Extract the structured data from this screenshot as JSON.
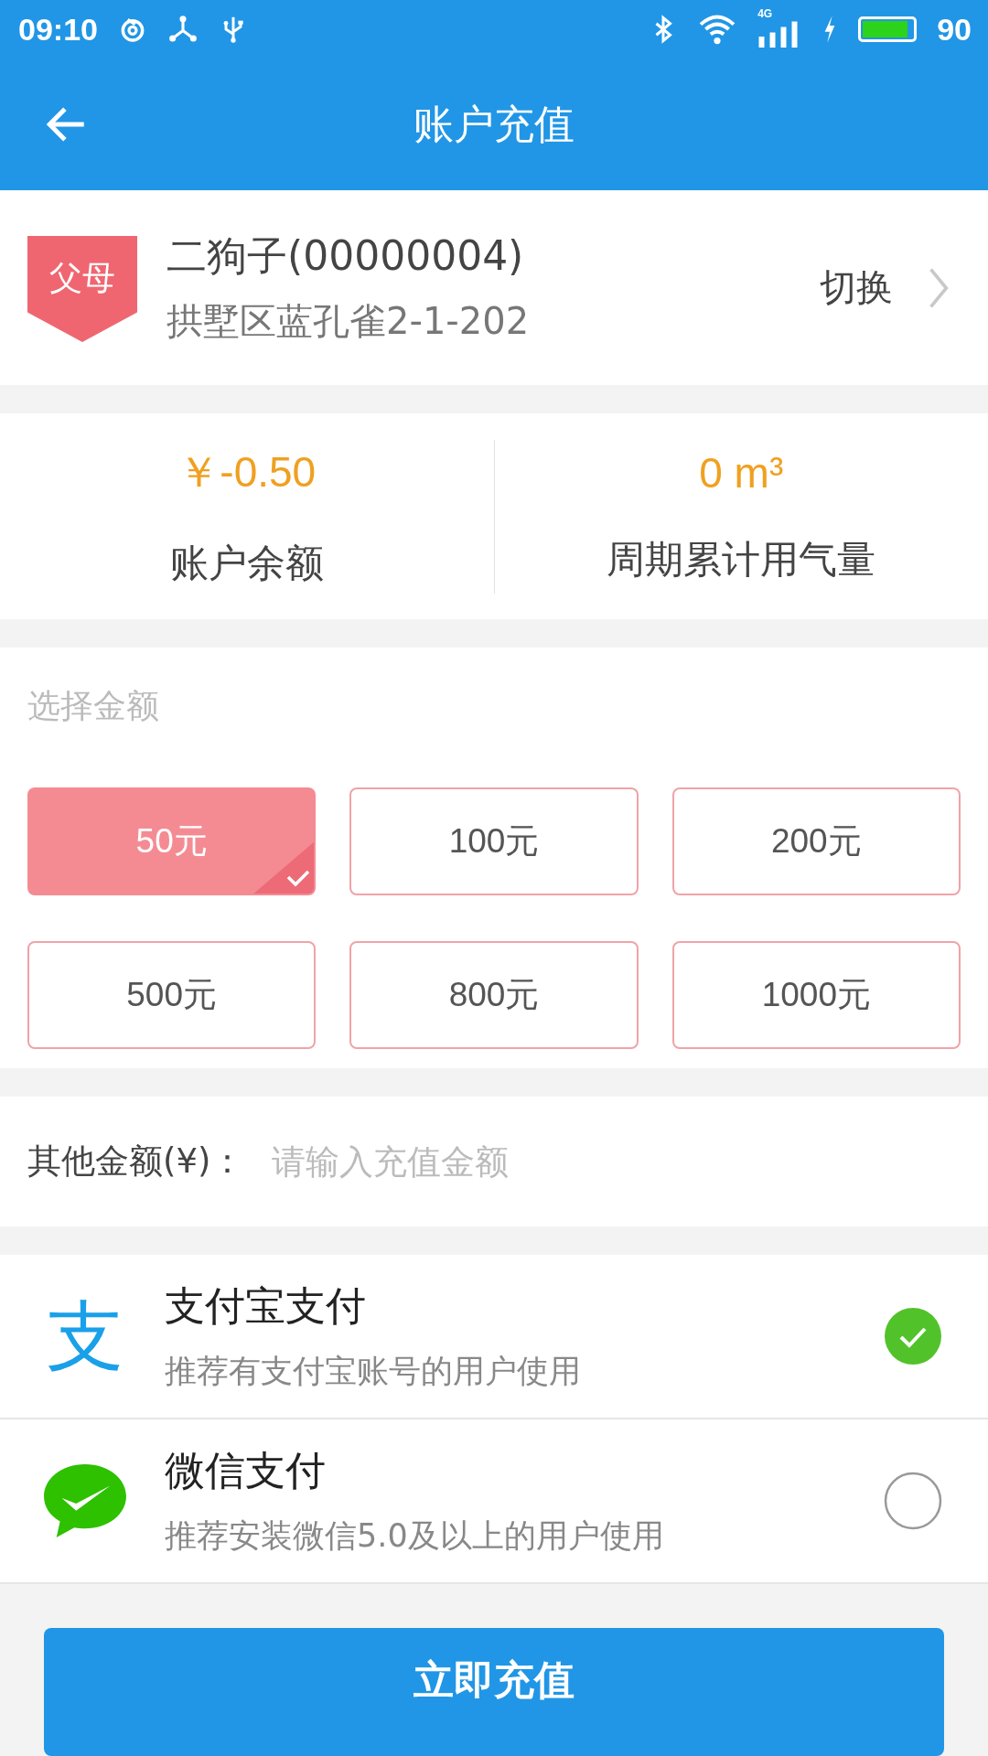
{
  "status_bar": {
    "time": "09:10",
    "network": "4G",
    "battery_text": "90"
  },
  "app_bar": {
    "title": "账户充值"
  },
  "account": {
    "badge": "父母",
    "name": "二狗子(00000004)",
    "address": "拱墅区蓝孔雀2-1-202",
    "switch_label": "切换"
  },
  "stats": [
    {
      "value": "￥-0.50",
      "label": "账户余额"
    },
    {
      "value": "0 m³",
      "label": "周期累计用气量"
    }
  ],
  "amount_section": {
    "title": "选择金额",
    "options": [
      {
        "label": "50元",
        "selected": true
      },
      {
        "label": "100元",
        "selected": false
      },
      {
        "label": "200元",
        "selected": false
      },
      {
        "label": "500元",
        "selected": false
      },
      {
        "label": "800元",
        "selected": false
      },
      {
        "label": "1000元",
        "selected": false
      }
    ]
  },
  "other_amount": {
    "label": "其他金额(¥)：",
    "placeholder": "请输入充值金额"
  },
  "payments": [
    {
      "kind": "alipay",
      "icon_text": "支",
      "title": "支付宝支付",
      "subtitle": "推荐有支付宝账号的用户使用",
      "selected": true
    },
    {
      "kind": "wechat",
      "title": "微信支付",
      "subtitle": "推荐安装微信5.0及以上的用户使用",
      "selected": false
    }
  ],
  "submit_button": "立即充值"
}
